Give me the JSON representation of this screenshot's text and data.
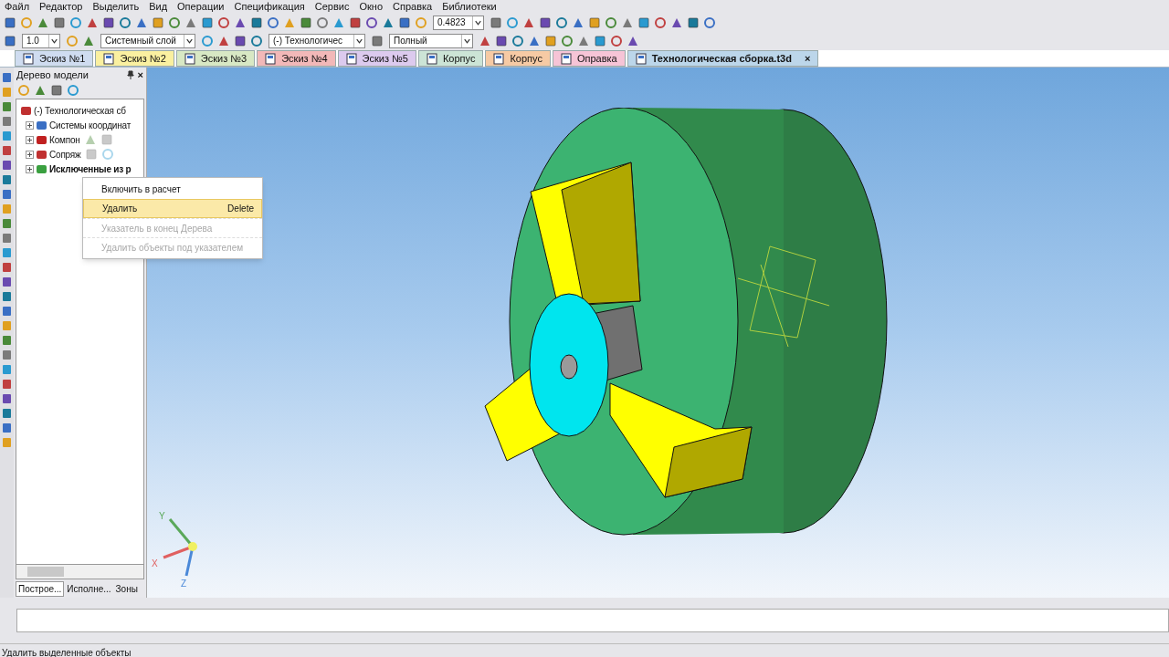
{
  "menu": [
    "Файл",
    "Редактор",
    "Выделить",
    "Вид",
    "Операции",
    "Спецификация",
    "Сервис",
    "Окно",
    "Справка",
    "Библиотеки"
  ],
  "toolbar": {
    "zoom": "0.4823"
  },
  "property_bar": {
    "step": "1.0",
    "layer": "Системный слой",
    "variant": "(-) Технологичес",
    "view": "Полный"
  },
  "tabs": [
    {
      "label": "Эскиз №1",
      "color": "#cfdcf0",
      "selected": false
    },
    {
      "label": "Эскиз №2",
      "color": "#faf0a0",
      "selected": false
    },
    {
      "label": "Эскиз №3",
      "color": "#d8e8c4",
      "selected": false
    },
    {
      "label": "Эскиз №4",
      "color": "#f2b8b8",
      "selected": false
    },
    {
      "label": "Эскиз №5",
      "color": "#dccaee",
      "selected": false
    },
    {
      "label": "Корпус",
      "color": "#cce4d6",
      "selected": false
    },
    {
      "label": "Корпус",
      "color": "#f6caa4",
      "selected": false
    },
    {
      "label": "Оправка",
      "color": "#f6c4d6",
      "selected": false
    },
    {
      "label": "Технологическая сборка.t3d",
      "color": "#bcd6ea",
      "selected": true,
      "close": "×"
    }
  ],
  "tree_panel": {
    "title": "Дерево модели",
    "close": "×",
    "items": [
      {
        "label": "(-) Технологическая сб",
        "bold": false,
        "children": [
          {
            "label": "Системы координат",
            "bold": false,
            "expanded": false
          },
          {
            "label": "Компон",
            "bold": false,
            "expanded": false
          },
          {
            "label": "Сопряж",
            "bold": false,
            "expanded": false
          },
          {
            "label": "Исключенные из р",
            "bold": true,
            "expanded": false
          }
        ]
      }
    ],
    "tabs": [
      {
        "label": "Построе...",
        "selected": true
      },
      {
        "label": "Исполне...",
        "selected": false
      },
      {
        "label": "Зоны",
        "selected": false
      }
    ]
  },
  "context_menu": [
    {
      "label": "Включить в расчет",
      "disabled": false,
      "selected": false
    },
    {
      "label": "Удалить",
      "shortcut": "Delete",
      "disabled": false,
      "selected": true
    },
    {
      "label": "Указатель в конец Дерева",
      "disabled": true,
      "selected": false
    },
    {
      "label": "Удалить объекты под указателем",
      "disabled": true,
      "selected": false
    }
  ],
  "axes": {
    "x": "X",
    "y": "Y",
    "z": "Z"
  },
  "status_bar": "Удалить выделенные объекты"
}
